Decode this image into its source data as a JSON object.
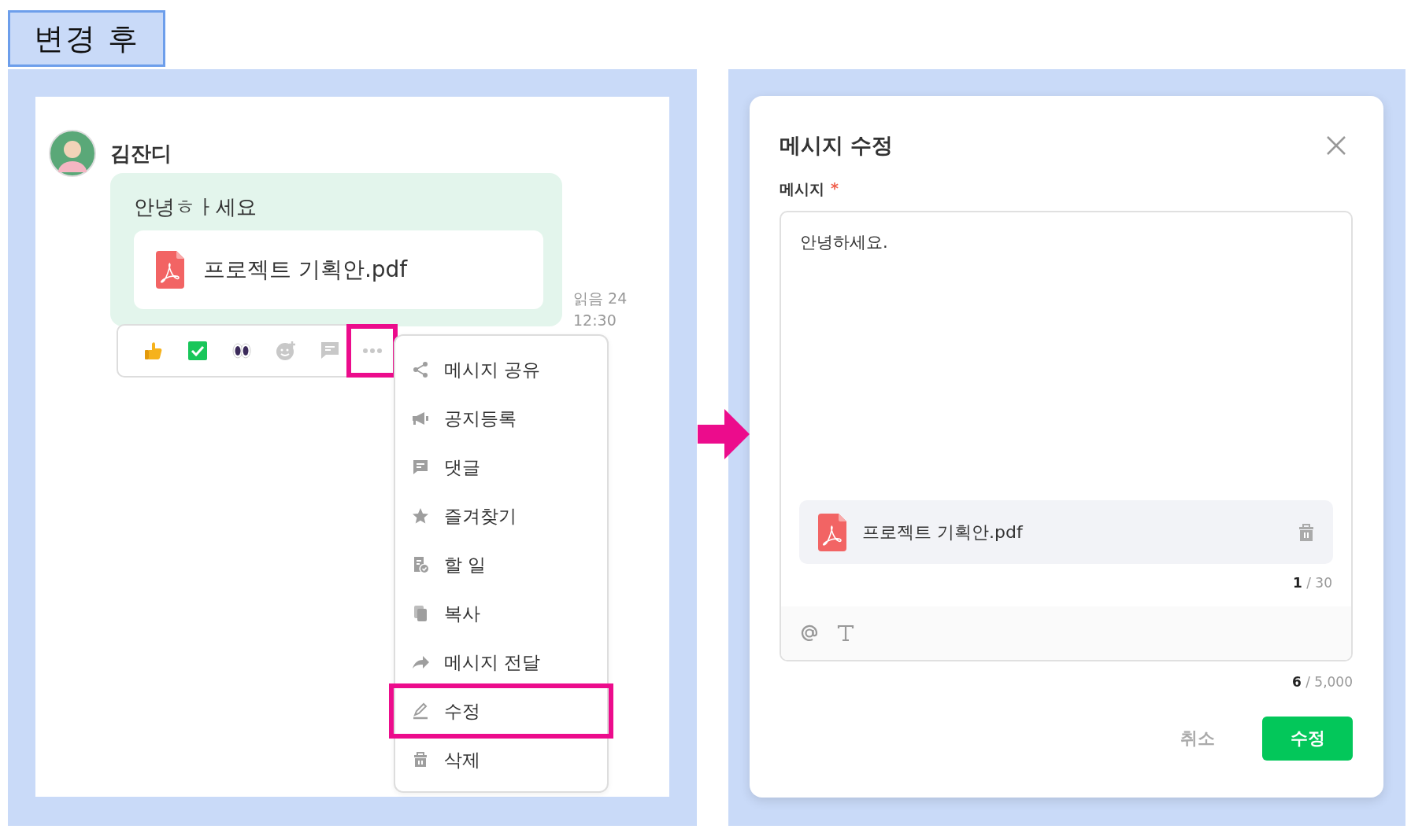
{
  "header_tag": {
    "label": "변경 후"
  },
  "chat": {
    "sender": "김잔디",
    "message": "안녕ㅎㅏ세요",
    "attachment": "프로젝트 기획안.pdf",
    "read_status": "읽음 24",
    "time": "12:30",
    "more_highlighted": true,
    "menu": [
      {
        "label": "메시지 공유",
        "highlighted": false
      },
      {
        "label": "공지등록",
        "highlighted": false
      },
      {
        "label": "댓글",
        "highlighted": false
      },
      {
        "label": "즐겨찾기",
        "highlighted": false
      },
      {
        "label": "할 일",
        "highlighted": false
      },
      {
        "label": "복사",
        "highlighted": false
      },
      {
        "label": "메시지 전달",
        "highlighted": false
      },
      {
        "label": "수정",
        "highlighted": true
      },
      {
        "label": "삭제",
        "highlighted": false
      }
    ]
  },
  "dialog": {
    "title": "메시지 수정",
    "field_label": "메시지",
    "required_mark": "*",
    "value": "안녕하세요.",
    "attachment": "프로젝트 기획안.pdf",
    "attachment_count": "**1** / 30",
    "char_count": "**6** / 5,000",
    "buttons": [
      {
        "label": "취소",
        "kind": "secondary"
      },
      {
        "label": "수정",
        "kind": "primary"
      }
    ]
  }
}
